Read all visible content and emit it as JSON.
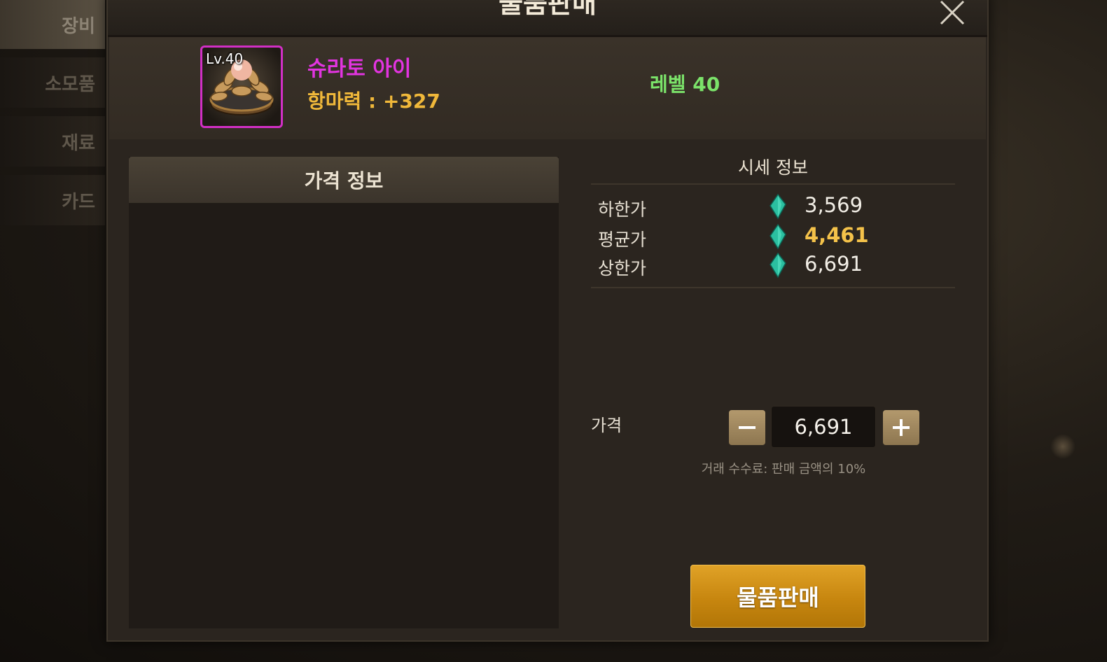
{
  "side_tabs": [
    "장비",
    "소모품",
    "재료",
    "카드"
  ],
  "dialog": {
    "title": "물품판매",
    "close_icon": "close-icon"
  },
  "item": {
    "level_badge": "Lv.40",
    "name": "슈라토 아이",
    "stat": "항마력 : +327",
    "required_level": "레벨 40",
    "rarity_color": "#d12fc5"
  },
  "price_panel": {
    "title": "가격 정보"
  },
  "market": {
    "title": "시세 정보",
    "currency_icon": "gem-icon",
    "rows": [
      {
        "label": "하한가",
        "value": "3,569"
      },
      {
        "label": "평균가",
        "value": "4,461"
      },
      {
        "label": "상한가",
        "value": "6,691"
      }
    ]
  },
  "price_input": {
    "label": "가격",
    "value": "6,691",
    "fee_note": "거래 수수료: 판매 금액의 10%"
  },
  "sell_button": {
    "label": "물품판매",
    "color": "#c7860f"
  }
}
